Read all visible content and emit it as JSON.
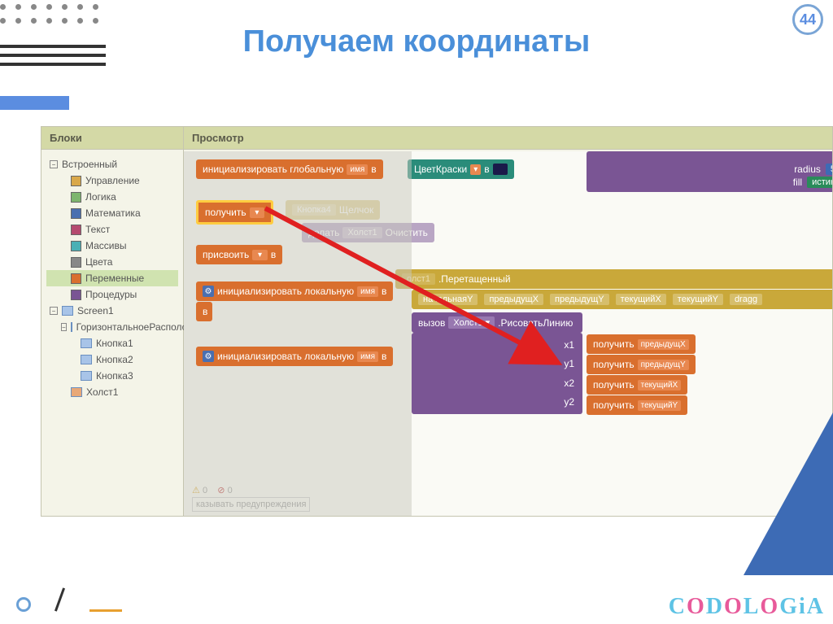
{
  "page_number": "44",
  "title": "Получаем координаты",
  "columns": {
    "blocks": "Блоки",
    "view": "Просмотр"
  },
  "palette": {
    "builtin": "Встроенный",
    "control": "Управление",
    "logic": "Логика",
    "math": "Математика",
    "text": "Текст",
    "lists": "Массивы",
    "colors": "Цвета",
    "variables": "Переменные",
    "procedures": "Процедуры",
    "screen": "Screen1",
    "horiz": "ГоризонтальноеРасполож",
    "btn1": "Кнопка1",
    "btn2": "Кнопка2",
    "btn3": "Кнопка3",
    "canvas": "Холст1"
  },
  "drawer": {
    "init_global": "инициализировать глобальную",
    "name": "имя",
    "to": "в",
    "get": "получить",
    "set": "присвоить",
    "init_local": "инициализировать локальную"
  },
  "canvas_blocks": {
    "paint_color": "ЦветКраски",
    "radius": "radius",
    "radius_val": "5",
    "fill": "fill",
    "fill_val": "истин",
    "btn4": "Кнопка4",
    "click": "Щелчок",
    "do": "делать",
    "canvas1": "Холст1",
    "clear": "Очистить",
    "dragged": ".Перетащенный",
    "startY": "начальнаяY",
    "prevX": "предыдущX",
    "prevY": "предыдущY",
    "curX": "текущийX",
    "curY": "текущийY",
    "dragg": "dragg",
    "call": "вызов",
    "drawline": ".РисоватьЛинию",
    "x1": "x1",
    "y1": "y1",
    "x2": "x2",
    "y2": "y2",
    "get2": "получить"
  },
  "status": {
    "warn_count": "0",
    "err_count": "0",
    "hint": "казывать предупреждения"
  },
  "logo": {
    "c": "C",
    "o1": "O",
    "d": "D",
    "o2": "O",
    "l": "L",
    "o3": "O",
    "g": "G",
    "i": "i",
    "a": "A"
  }
}
